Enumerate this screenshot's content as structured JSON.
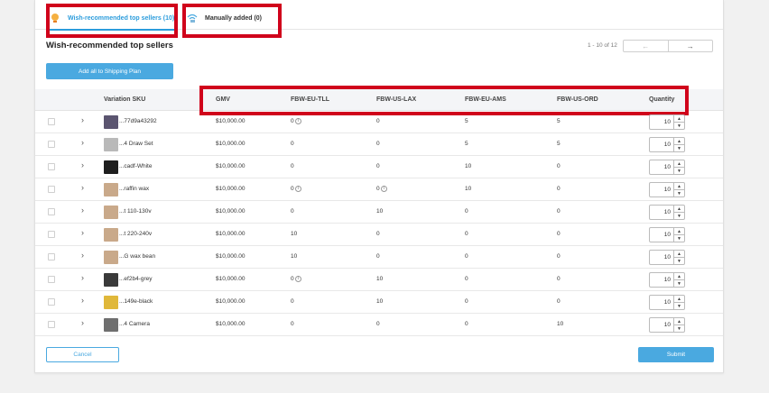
{
  "tabs": [
    {
      "label": "Wish-recommended top sellers (10)",
      "icon": "lightbulb-icon",
      "active": true
    },
    {
      "label": "Manually added (0)",
      "icon": "wifi-hand-icon",
      "active": false
    }
  ],
  "section_title": "Wish-recommended top sellers",
  "pagination": {
    "text": "1 - 10 of 12",
    "prev": "←",
    "next": "→"
  },
  "add_all_button": "Add all to Shipping Plan",
  "columns": [
    "Variation SKU",
    "GMV",
    "FBW-EU-TLL",
    "FBW-US-LAX",
    "FBW-EU-AMS",
    "FBW-US-ORD",
    "Quantity"
  ],
  "rows": [
    {
      "sku": "...77d9a43292",
      "gmv": "$10,000.00",
      "tll": "0",
      "tll_info": true,
      "lax": "0",
      "lax_info": false,
      "ams": "5",
      "ord": "5",
      "qty": "10",
      "thumb": "#5b5570"
    },
    {
      "sku": "...4 Draw Set",
      "gmv": "$10,000.00",
      "tll": "0",
      "tll_info": false,
      "lax": "0",
      "lax_info": false,
      "ams": "5",
      "ord": "5",
      "qty": "10",
      "thumb": "#b9b9b9"
    },
    {
      "sku": "...cadf-White",
      "gmv": "$10,000.00",
      "tll": "0",
      "tll_info": false,
      "lax": "0",
      "lax_info": false,
      "ams": "10",
      "ord": "0",
      "qty": "10",
      "thumb": "#1e1e1e"
    },
    {
      "sku": "...raffin wax",
      "gmv": "$10,000.00",
      "tll": "0",
      "tll_info": true,
      "lax": "0",
      "lax_info": true,
      "ams": "10",
      "ord": "0",
      "qty": "10",
      "thumb": "#c9a98a"
    },
    {
      "sku": "...t 110-130v",
      "gmv": "$10,000.00",
      "tll": "0",
      "tll_info": false,
      "lax": "10",
      "lax_info": false,
      "ams": "0",
      "ord": "0",
      "qty": "10",
      "thumb": "#c9a98a"
    },
    {
      "sku": "...t 220-240v",
      "gmv": "$10,000.00",
      "tll": "10",
      "tll_info": false,
      "lax": "0",
      "lax_info": false,
      "ams": "0",
      "ord": "0",
      "qty": "10",
      "thumb": "#c9a98a"
    },
    {
      "sku": "...G wax bean",
      "gmv": "$10,000.00",
      "tll": "10",
      "tll_info": false,
      "lax": "0",
      "lax_info": false,
      "ams": "0",
      "ord": "0",
      "qty": "10",
      "thumb": "#c9a98a"
    },
    {
      "sku": "...ef2b4-grey",
      "gmv": "$10,000.00",
      "tll": "0",
      "tll_info": true,
      "lax": "10",
      "lax_info": false,
      "ams": "0",
      "ord": "0",
      "qty": "10",
      "thumb": "#3a3a3a"
    },
    {
      "sku": "...149e-black",
      "gmv": "$10,000.00",
      "tll": "0",
      "tll_info": false,
      "lax": "10",
      "lax_info": false,
      "ams": "0",
      "ord": "0",
      "qty": "10",
      "thumb": "#e0b83a"
    },
    {
      "sku": "...4 Camera",
      "gmv": "$10,000.00",
      "tll": "0",
      "tll_info": false,
      "lax": "0",
      "lax_info": false,
      "ams": "0",
      "ord": "10",
      "qty": "10",
      "thumb": "#6f6f6f"
    }
  ],
  "info_glyph": "i",
  "spin_up": "▲",
  "spin_down": "▼",
  "row_chevron": "›",
  "cancel_button": "Cancel",
  "submit_button": "Submit",
  "colors": {
    "accent": "#4aa9e0",
    "highlight": "#d0021b"
  }
}
